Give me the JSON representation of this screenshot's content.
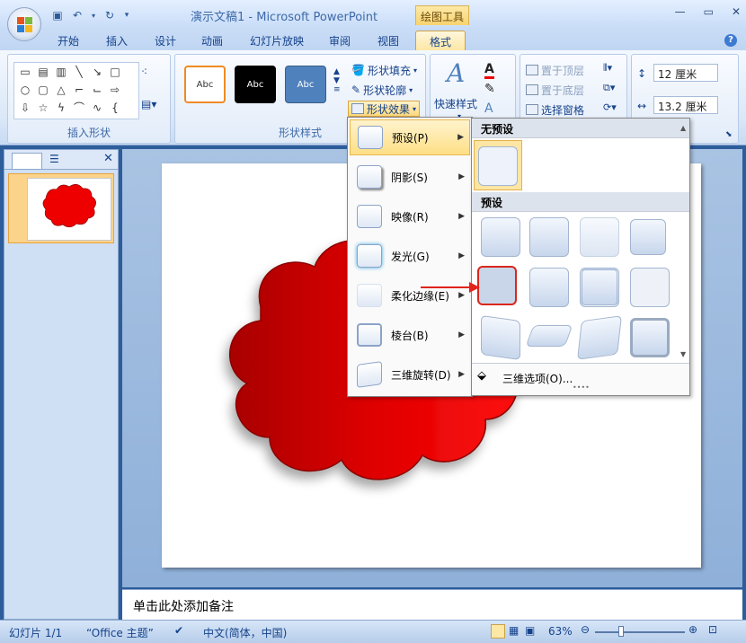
{
  "window": {
    "title": "演示文稿1 - Microsoft PowerPoint",
    "contextual_tab_group": "绘图工具"
  },
  "tabs": [
    "开始",
    "插入",
    "设计",
    "动画",
    "幻灯片放映",
    "审阅",
    "视图",
    "格式"
  ],
  "ribbon": {
    "groups": {
      "insert_shapes": "插入形状",
      "shape_styles": "形状样式"
    },
    "style_samples": [
      "Abc",
      "Abc",
      "Abc"
    ],
    "shape_fill": "形状填充",
    "shape_outline": "形状轮廓",
    "shape_effects": "形状效果",
    "quick_styles": "快速样式",
    "bring_front": "置于顶层",
    "send_back": "置于底层",
    "selection_pane": "选择窗格",
    "height": "12 厘米",
    "width": "13.2 厘米"
  },
  "effects_menu": [
    {
      "label": "预设(P)"
    },
    {
      "label": "阴影(S)"
    },
    {
      "label": "映像(R)"
    },
    {
      "label": "发光(G)"
    },
    {
      "label": "柔化边缘(E)"
    },
    {
      "label": "棱台(B)"
    },
    {
      "label": "三维旋转(D)"
    }
  ],
  "preset_panel": {
    "section_none": "无预设",
    "section_presets": "预设",
    "footer": "三维选项(O)..."
  },
  "slide_pane": {
    "slide_number": "1"
  },
  "notes_placeholder": "单击此处添加备注",
  "status": {
    "slide": "幻灯片 1/1",
    "theme": "“Office 主题”",
    "language": "中文(简体，中国)",
    "zoom": "63%"
  },
  "colors": {
    "shape_red": "#e00000",
    "accent": "#15428b"
  }
}
